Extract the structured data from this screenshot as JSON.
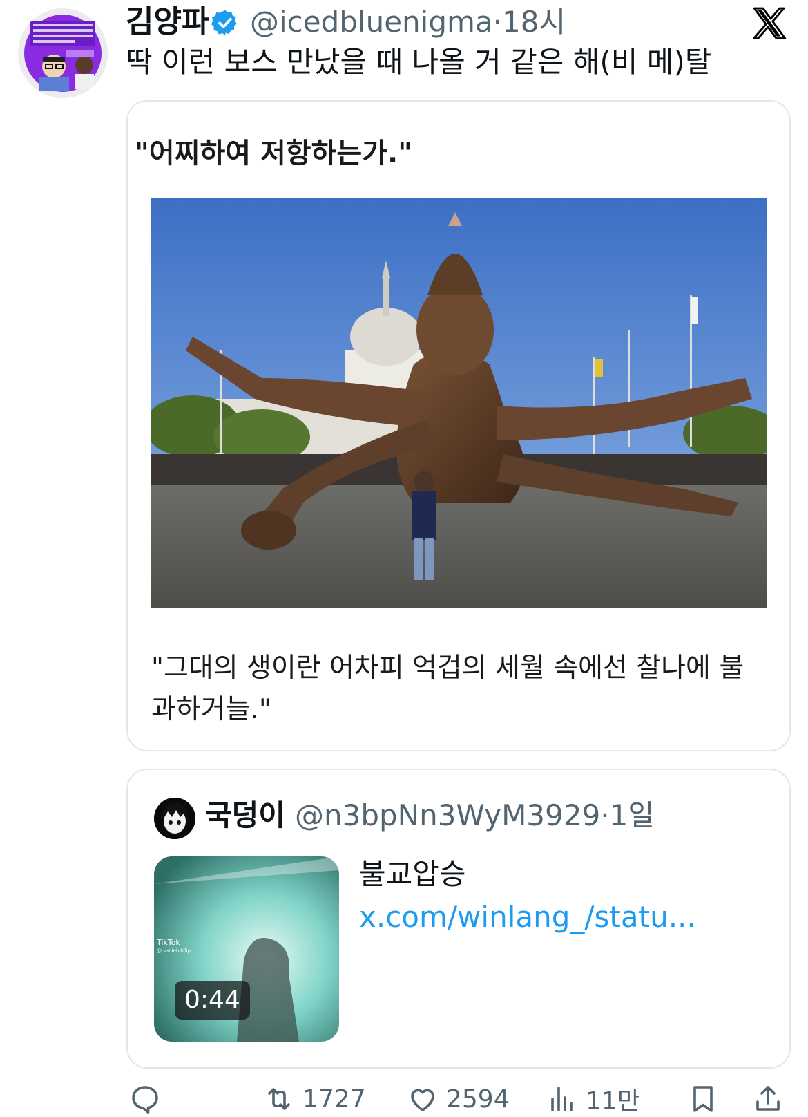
{
  "tweet": {
    "display_name": "김양파",
    "handle": "@icedbluenigma",
    "separator": "·",
    "time": "18시",
    "text": "딱 이런 보스 만났을 때 나올 거 같은 해(비 메)탈"
  },
  "image_card": {
    "quote_top": "\"어찌하여 저항하는가.\"",
    "quote_bottom": "\"그대의 생이란 어차피 억겁의 세월 속에선 찰나에 불과하거늘.\""
  },
  "quoted_tweet": {
    "display_name": "국덩이",
    "handle": "@n3bpNn3WyM3929",
    "separator": "·",
    "time": "1일",
    "text": "불교압승",
    "link_text": "x.com/winlang_/statu...",
    "video_duration": "0:44",
    "video_watermark": "TikTok",
    "video_watermark_user": "@ sablehillflip"
  },
  "actions": {
    "reply_count": "",
    "retweet_count": "1727",
    "like_count": "2594",
    "views_count": "11만"
  },
  "colors": {
    "accent": "#1d9bf0",
    "secondary_text": "#536471",
    "border": "#e3e7ea"
  },
  "icons": [
    "verified-badge-icon",
    "x-logo-icon",
    "reply-icon",
    "retweet-icon",
    "like-icon",
    "views-icon",
    "bookmark-icon",
    "share-icon"
  ]
}
